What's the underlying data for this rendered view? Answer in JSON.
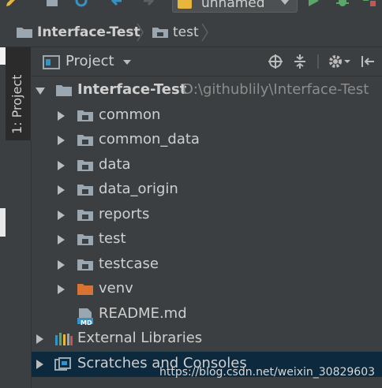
{
  "toolbar": {
    "run_config": "unnamed"
  },
  "nav": {
    "crumbs": [
      "Interface-Test",
      "test"
    ]
  },
  "side": {
    "tab_label": "1: Project"
  },
  "panel": {
    "title": "Project"
  },
  "tree": {
    "root_name": "Interface-Test",
    "root_path": "D:\\githublily\\Interface-Test",
    "items": [
      "common",
      "common_data",
      "data",
      "data_origin",
      "reports",
      "test",
      "testcase",
      "venv",
      "README.md"
    ],
    "readme_icon_text": "MD",
    "external": "External Libraries",
    "scratches": "Scratches and Consoles"
  },
  "watermark": "https://blog.csdn.net/weixin_30829603",
  "colors": {
    "background": "#3c3f41",
    "selection": "#0d293e",
    "folder": "#9aa7b0",
    "excluded_folder": "#d87431",
    "run": "#59a869"
  }
}
